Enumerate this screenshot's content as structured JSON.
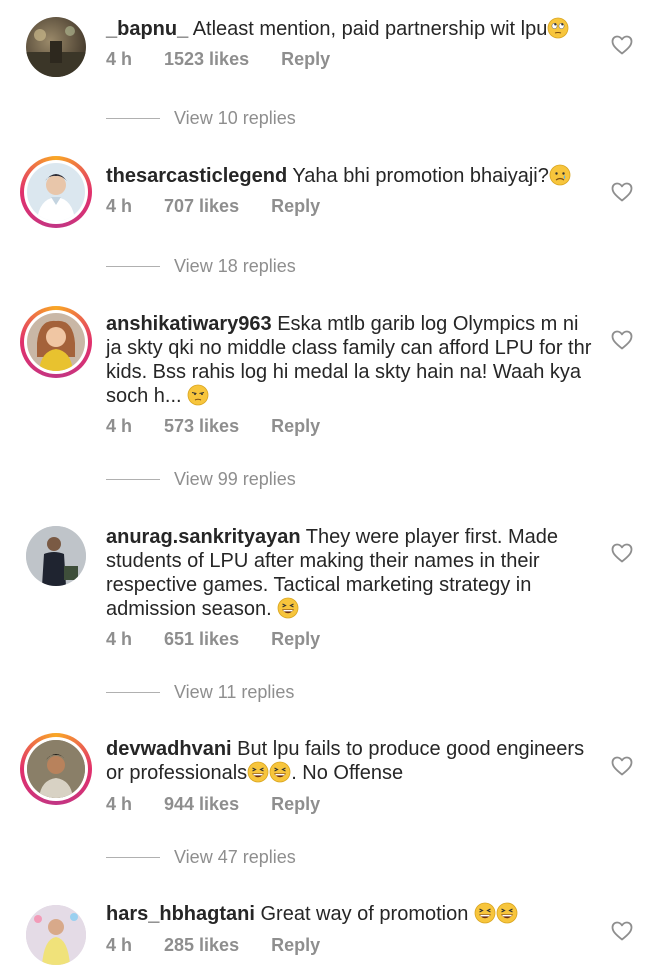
{
  "comments": [
    {
      "username": "_bapnu_",
      "text": "Atleast mention, paid partnership wit lpu",
      "emoji": [
        "rolling-eyes"
      ],
      "time": "4 h",
      "likes": "1523 likes",
      "reply": "Reply",
      "view_replies": "View 10 replies",
      "story_ring": false
    },
    {
      "username": "thesarcasticlegend",
      "text": "Yaha bhi promotion bhaiyaji?",
      "emoji": [
        "crying"
      ],
      "time": "4 h",
      "likes": "707 likes",
      "reply": "Reply",
      "view_replies": "View 18 replies",
      "story_ring": true
    },
    {
      "username": "anshikatiwary963",
      "text": "Eska mtlb garib log Olympics m ni ja skty qki no middle class family can afford LPU for thr kids. Bss rahis log hi medal la skty hain na! Waah kya soch h...",
      "emoji": [
        "unamused"
      ],
      "time": "4 h",
      "likes": "573 likes",
      "reply": "Reply",
      "view_replies": "View 99 replies",
      "story_ring": true
    },
    {
      "username": "anurag.sankrityayan",
      "text": "They were player first. Made students of LPU after making their names in their respective games. Tactical marketing strategy in admission season.",
      "emoji": [
        "grinning-squint"
      ],
      "time": "4 h",
      "likes": "651 likes",
      "reply": "Reply",
      "view_replies": "View 11 replies",
      "story_ring": false
    },
    {
      "username": "devwadhvani",
      "text_before": "But lpu fails to produce good engineers or professionals",
      "text_after": ". No Offense",
      "emoji": [
        "grinning-squint",
        "grinning-squint"
      ],
      "time": "4 h",
      "likes": "944 likes",
      "reply": "Reply",
      "view_replies": "View 47 replies",
      "story_ring": true
    },
    {
      "username": "hars_hbhagtani",
      "text": "Great way of promotion",
      "emoji": [
        "grinning-squint",
        "grinning-squint"
      ],
      "time": "4 h",
      "likes": "285 likes",
      "reply": "Reply",
      "story_ring": false
    }
  ],
  "colors": {
    "text": "#262626",
    "muted": "#8e8e8e",
    "emoji_yellow": "#f7c53c"
  }
}
